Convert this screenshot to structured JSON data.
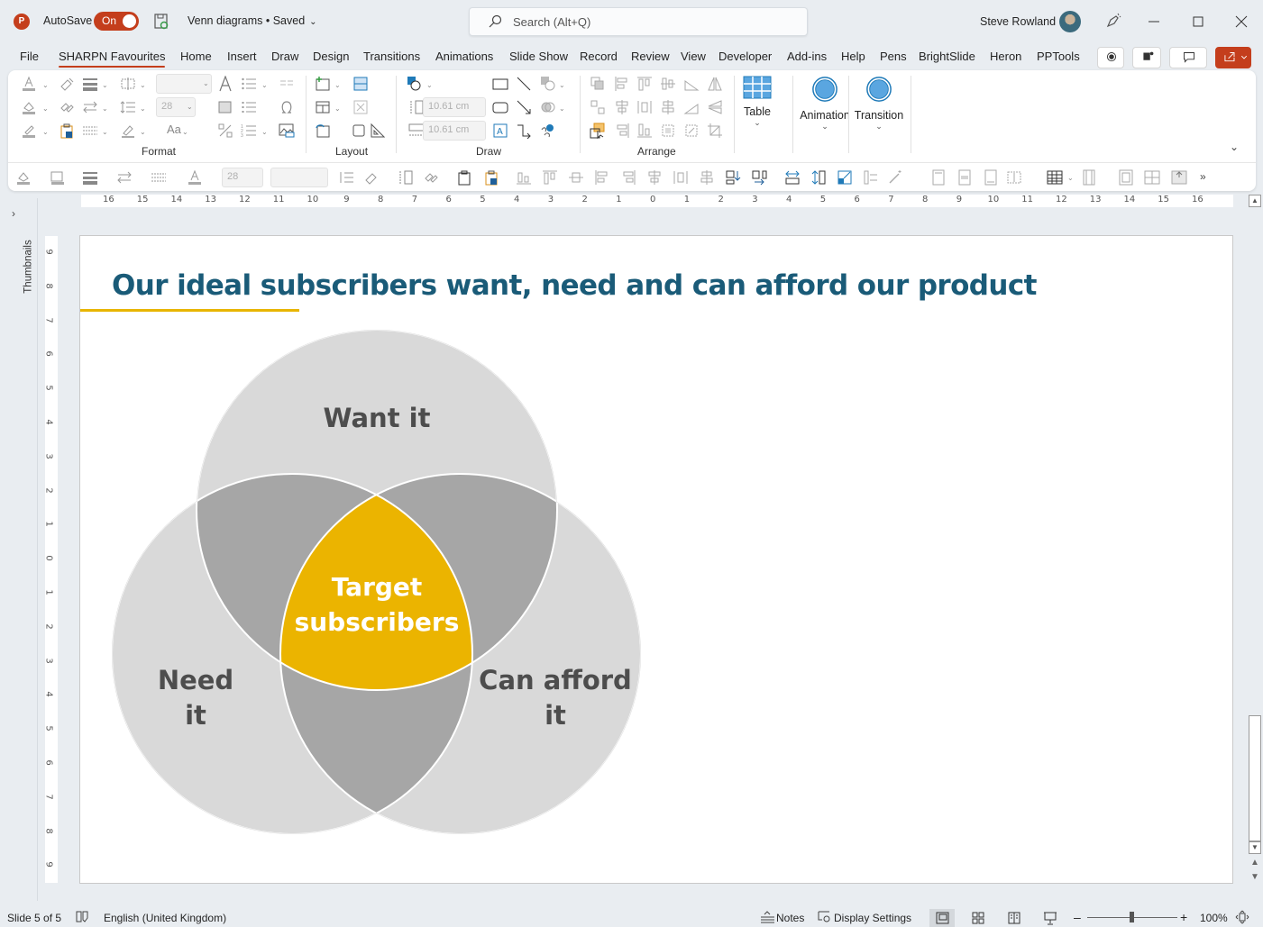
{
  "titlebar": {
    "app_logo": "P",
    "autosave_label": "AutoSave",
    "autosave_state": "On",
    "document_title": "Venn diagrams • Saved",
    "search_placeholder": "Search (Alt+Q)",
    "user_name": "Steve Rowland"
  },
  "tabs": [
    {
      "label": "File"
    },
    {
      "label": "SHARPN Favourites",
      "active": true
    },
    {
      "label": "Home"
    },
    {
      "label": "Insert"
    },
    {
      "label": "Draw"
    },
    {
      "label": "Design"
    },
    {
      "label": "Transitions"
    },
    {
      "label": "Animations"
    },
    {
      "label": "Slide Show"
    },
    {
      "label": "Record"
    },
    {
      "label": "Review"
    },
    {
      "label": "View"
    },
    {
      "label": "Developer"
    },
    {
      "label": "Add-ins"
    },
    {
      "label": "Help"
    },
    {
      "label": "Pens"
    },
    {
      "label": "BrightSlide"
    },
    {
      "label": "Heron"
    },
    {
      "label": "PPTools"
    }
  ],
  "ribbon": {
    "groups": {
      "format": "Format",
      "layout": "Layout",
      "draw": "Draw",
      "arrange": "Arrange"
    },
    "font_size_value": "28",
    "shape_height": "10.61 cm",
    "shape_width": "10.61 cm",
    "case_label": "Aa",
    "table_label": "Table",
    "animation_label": "Animation",
    "transition_label": "Transition",
    "qa_font_size": "28"
  },
  "rulers": {
    "horizontal": [
      "16",
      "15",
      "14",
      "13",
      "12",
      "11",
      "10",
      "9",
      "8",
      "7",
      "6",
      "5",
      "4",
      "3",
      "2",
      "1",
      "0",
      "1",
      "2",
      "3",
      "4",
      "5",
      "6",
      "7",
      "8",
      "9",
      "10",
      "11",
      "12",
      "13",
      "14",
      "15",
      "16"
    ],
    "vertical": [
      "9",
      "8",
      "7",
      "6",
      "5",
      "4",
      "3",
      "2",
      "1",
      "0",
      "1",
      "2",
      "3",
      "4",
      "5",
      "6",
      "7",
      "8",
      "9"
    ]
  },
  "thumbnails_label": "Thumbnails",
  "slide": {
    "title": "Our ideal subscribers want, need and can afford our product",
    "colors": {
      "title": "#1a5b78",
      "accent": "#e8b500",
      "circle": "#d9d9d9",
      "overlap": "#a6a6a6",
      "center": "#ebb400",
      "label": "#4d4d4d"
    },
    "venn": {
      "sets": [
        {
          "id": "want",
          "label_lines": [
            "Want it"
          ]
        },
        {
          "id": "need",
          "label_lines": [
            "Need",
            "it"
          ]
        },
        {
          "id": "afford",
          "label_lines": [
            "Can afford",
            "it"
          ]
        }
      ],
      "center_label_lines": [
        "Target",
        "subscribers"
      ]
    }
  },
  "statusbar": {
    "slide_indicator": "Slide 5 of 5",
    "language": "English (United Kingdom)",
    "notes_label": "Notes",
    "display_settings_label": "Display Settings",
    "zoom_level": "100%",
    "zoom_fraction": 0.5
  }
}
